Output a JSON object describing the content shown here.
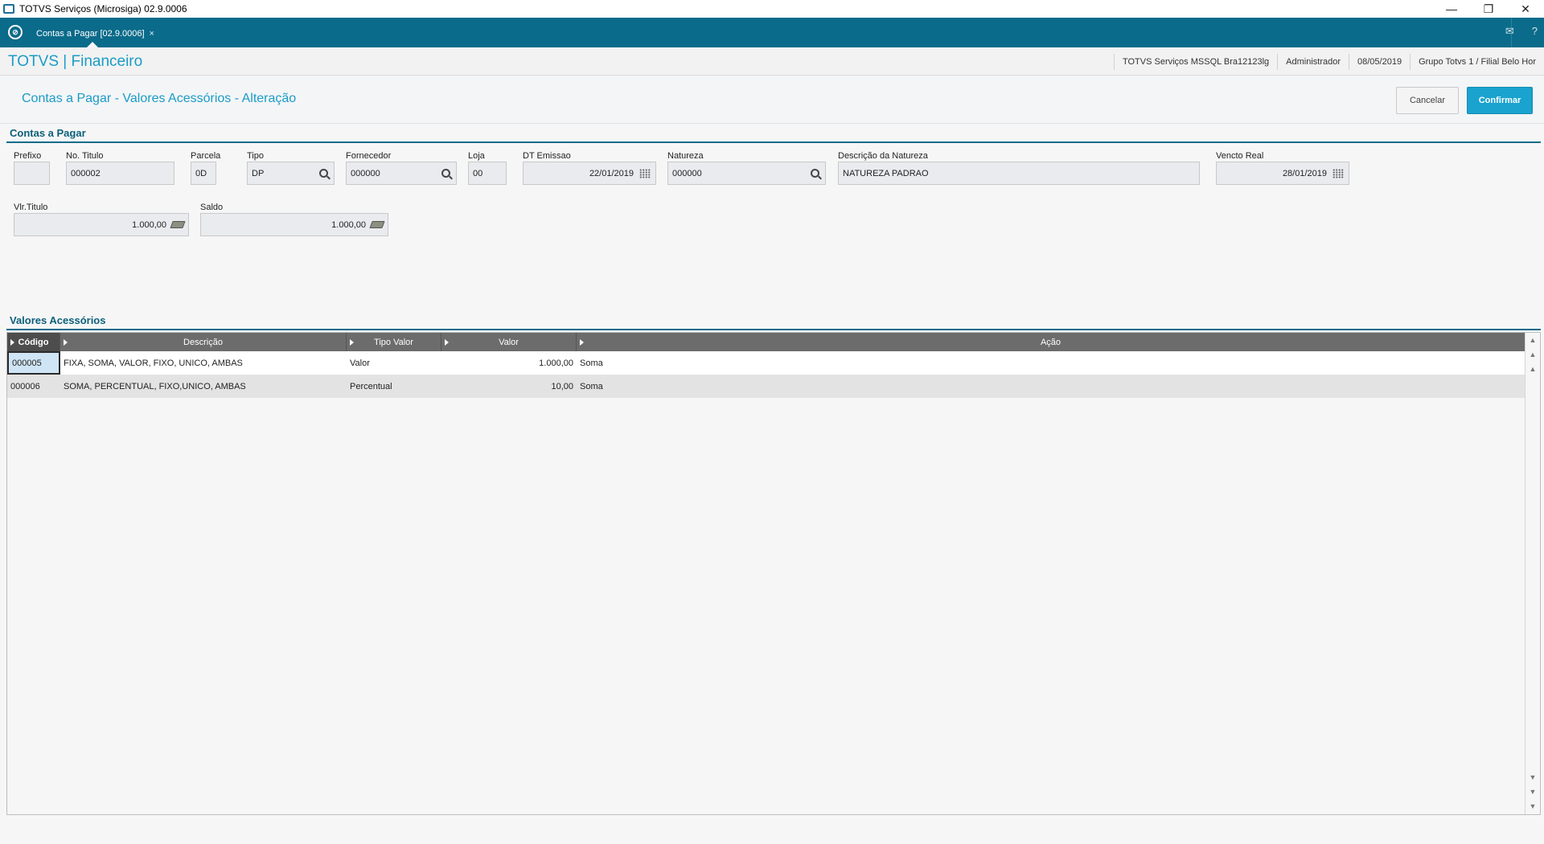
{
  "window": {
    "title": "TOTVS Serviços (Microsiga) 02.9.0006",
    "minimize": "—",
    "restore": "❐",
    "close": "✕"
  },
  "tabbar": {
    "tab_label": "Contas a Pagar [02.9.0006]",
    "tab_close": "×",
    "mail_icon": "✉",
    "help_icon": "?"
  },
  "header": {
    "brand": "TOTVS | Financeiro",
    "session": [
      "TOTVS Serviços MSSQL Bra12123lg",
      "Administrador",
      "08/05/2019",
      "Grupo Totvs 1 / Filial Belo Hor"
    ]
  },
  "page": {
    "title": "Contas a Pagar - Valores Acessórios - Alteração",
    "cancel_label": "Cancelar",
    "confirm_label": "Confirmar"
  },
  "form": {
    "section_title": "Contas a Pagar",
    "prefixo": {
      "label": "Prefixo",
      "value": ""
    },
    "titulo": {
      "label": "No. Titulo",
      "value": "000002"
    },
    "parcela": {
      "label": "Parcela",
      "value": "0D"
    },
    "tipo": {
      "label": "Tipo",
      "value": "DP"
    },
    "fornecedor": {
      "label": "Fornecedor",
      "value": "000000"
    },
    "loja": {
      "label": "Loja",
      "value": "00"
    },
    "dt_emissao": {
      "label": "DT Emissao",
      "value": "22/01/2019"
    },
    "natureza": {
      "label": "Natureza",
      "value": "000000"
    },
    "desc_natureza": {
      "label": "Descrição da Natureza",
      "value": "NATUREZA PADRAO"
    },
    "vencto_real": {
      "label": "Vencto Real",
      "value": "28/01/2019"
    },
    "vlr_titulo": {
      "label": "Vlr.Titulo",
      "value": "1.000,00"
    },
    "saldo": {
      "label": "Saldo",
      "value": "1.000,00"
    }
  },
  "grid": {
    "section_title": "Valores Acessórios",
    "columns": [
      "Código",
      "Descrição",
      "Tipo Valor",
      "Valor",
      "Ação"
    ],
    "rows": [
      {
        "codigo": "000005",
        "descricao": "FIXA, SOMA, VALOR, FIXO, UNICO, AMBAS",
        "tipo_valor": "Valor",
        "valor": "1.000,00",
        "acao": "Soma"
      },
      {
        "codigo": "000006",
        "descricao": "SOMA, PERCENTUAL, FIXO,UNICO, AMBAS",
        "tipo_valor": "Percentual",
        "valor": "10,00",
        "acao": "Soma"
      }
    ],
    "scroll_up": "▲",
    "scroll_down": "▼"
  },
  "colors": {
    "accent": "#0b6b8a",
    "title_blue": "#1a9cc7",
    "confirm_button": "#1aa3cf",
    "grid_header": "#6c6c6c"
  }
}
